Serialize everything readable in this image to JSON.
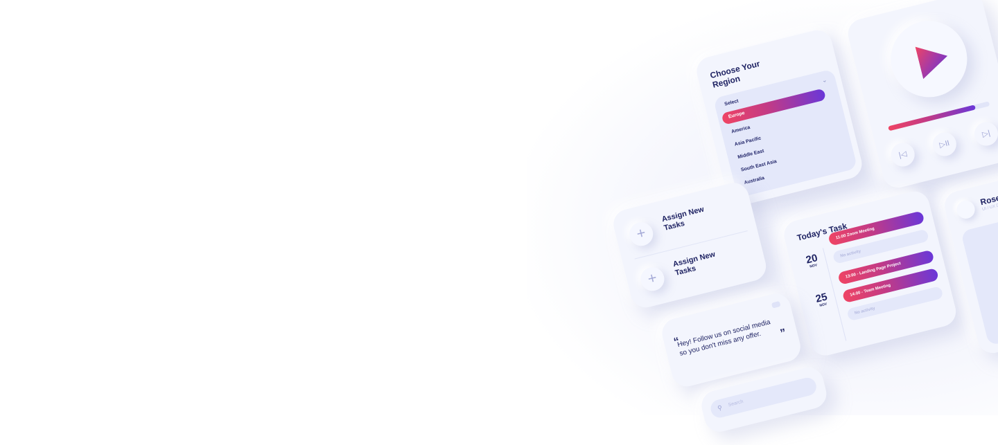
{
  "region": {
    "title": "Choose Your Region",
    "select_label": "Select",
    "selected": "Europe",
    "options": [
      "America",
      "Asia Pacific",
      "Middle East",
      "South East Asia",
      "Australia"
    ]
  },
  "assign": {
    "items": [
      {
        "label": "Assign New Tasks"
      },
      {
        "label": "Assign New Tasks"
      }
    ]
  },
  "quote": {
    "open": "“",
    "text": "Hey! Follow us on social media so you don't miss any offer.",
    "close": "”"
  },
  "today": {
    "title": "Today's Task",
    "dates": [
      {
        "day": "20",
        "month": "NOV"
      },
      {
        "day": "25",
        "month": "NOV"
      }
    ],
    "tasks": [
      {
        "text": "11:00 Zoom Meeting"
      },
      {
        "text": "No activity"
      },
      {
        "text": "13:00 - Landing Page Project"
      },
      {
        "text": "14:00 - Team Meeting"
      },
      {
        "text": "No activity"
      }
    ]
  },
  "profile": {
    "name": "Rose Stewart",
    "subtitle": "UI / UX Designer"
  },
  "player": {
    "progress": 0.86,
    "controls": [
      "prev",
      "play-pause",
      "next"
    ]
  },
  "search": {
    "placeholder": "Search"
  },
  "colors": {
    "gradient_start": "#ef4464",
    "gradient_end": "#6a37d8",
    "text_navy": "#1f2363",
    "card_bg": "#f3f5fd"
  }
}
